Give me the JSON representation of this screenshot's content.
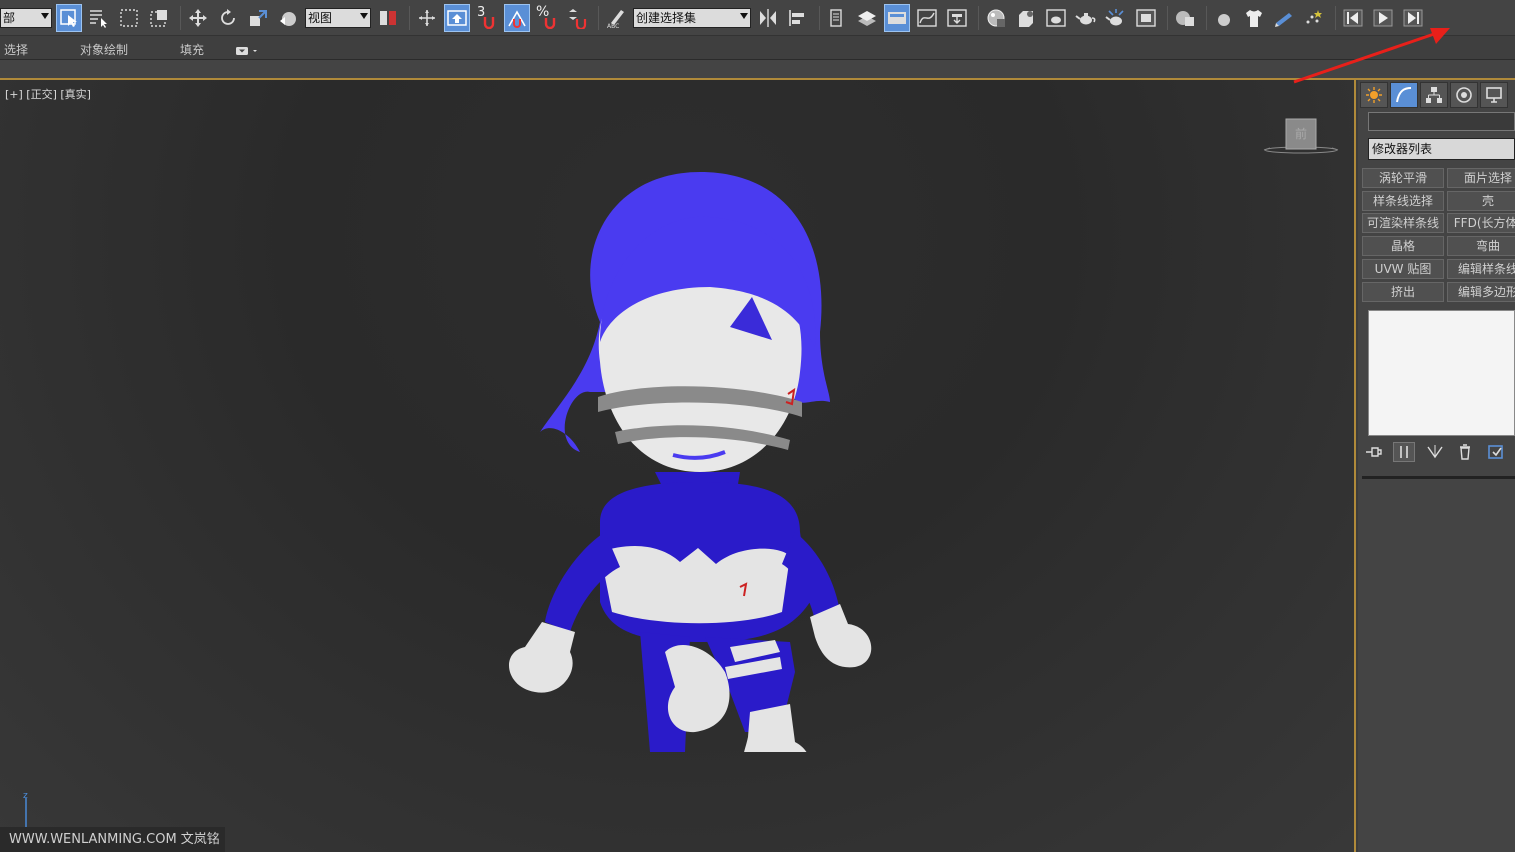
{
  "toolbar": {
    "selection_filter": "部",
    "view_dropdown": "视图",
    "named_selection": "创建选择集",
    "snap_number": "3",
    "percent_sign": "%"
  },
  "ribbon": {
    "tabs": [
      "选择",
      "对象绘制",
      "填充"
    ]
  },
  "viewport": {
    "label": "[+] [正交] [真实]",
    "viewcube_face": "前",
    "axis_z": "z"
  },
  "watermark": "WWW.WENLANMING.COM  文岚铭",
  "command_panel": {
    "modifier_list": "修改器列表",
    "modifier_buttons": [
      {
        "label": "涡轮平滑"
      },
      {
        "label": "面片选择"
      },
      {
        "label": "样条线选择"
      },
      {
        "label": "壳"
      },
      {
        "label": "可渲染样条线"
      },
      {
        "label": "FFD(长方体)"
      },
      {
        "label": "晶格"
      },
      {
        "label": "弯曲"
      },
      {
        "label": "UVW 贴图"
      },
      {
        "label": "编辑样条线"
      },
      {
        "label": "挤出"
      },
      {
        "label": "编辑多边形"
      }
    ]
  },
  "colors": {
    "accent_active": "#5a8fd6",
    "viewport_border": "#b08a3a",
    "annotation_arrow": "#e8201a",
    "character_blue": "#2a1bc9",
    "hair_blue": "#4a3bf0"
  }
}
